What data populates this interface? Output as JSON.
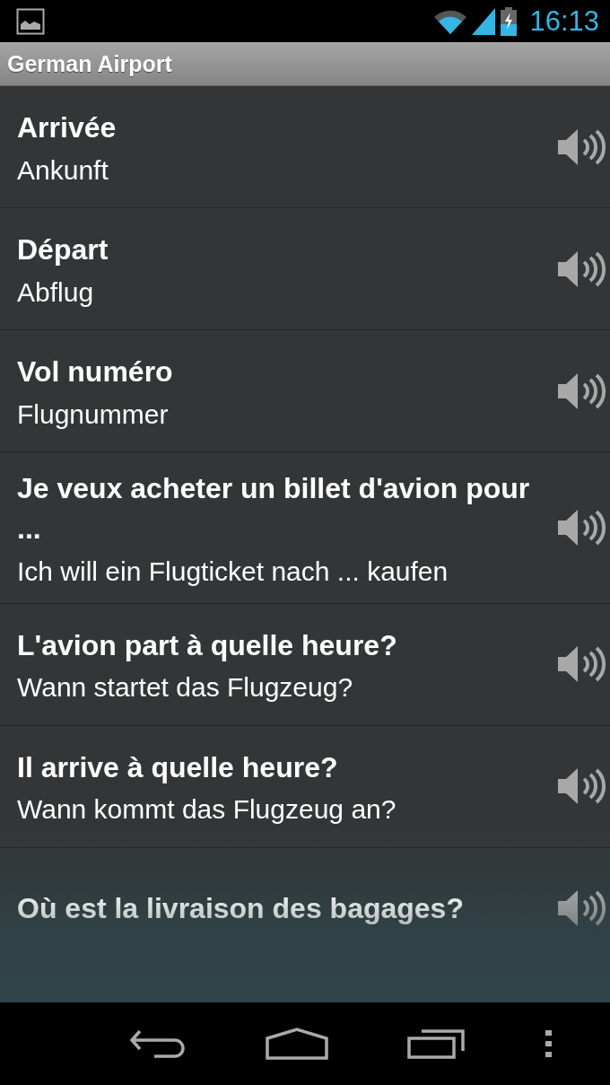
{
  "status_bar": {
    "time": "16:13"
  },
  "action_bar": {
    "title": "German Airport"
  },
  "phrases": [
    {
      "title": "Arrivée",
      "translation": "Ankunft"
    },
    {
      "title": "Départ",
      "translation": "Abflug"
    },
    {
      "title": "Vol numéro",
      "translation": "Flugnummer"
    },
    {
      "title": "Je veux acheter un billet d'avion pour ...",
      "translation": "Ich will ein Flugticket nach ... kaufen"
    },
    {
      "title": "L'avion part à quelle heure?",
      "translation": "Wann startet das Flugzeug?"
    },
    {
      "title": "Il arrive à quelle heure?",
      "translation": "Wann kommt das Flugzeug an?"
    },
    {
      "title": "Où est la livraison des bagages?"
    }
  ]
}
